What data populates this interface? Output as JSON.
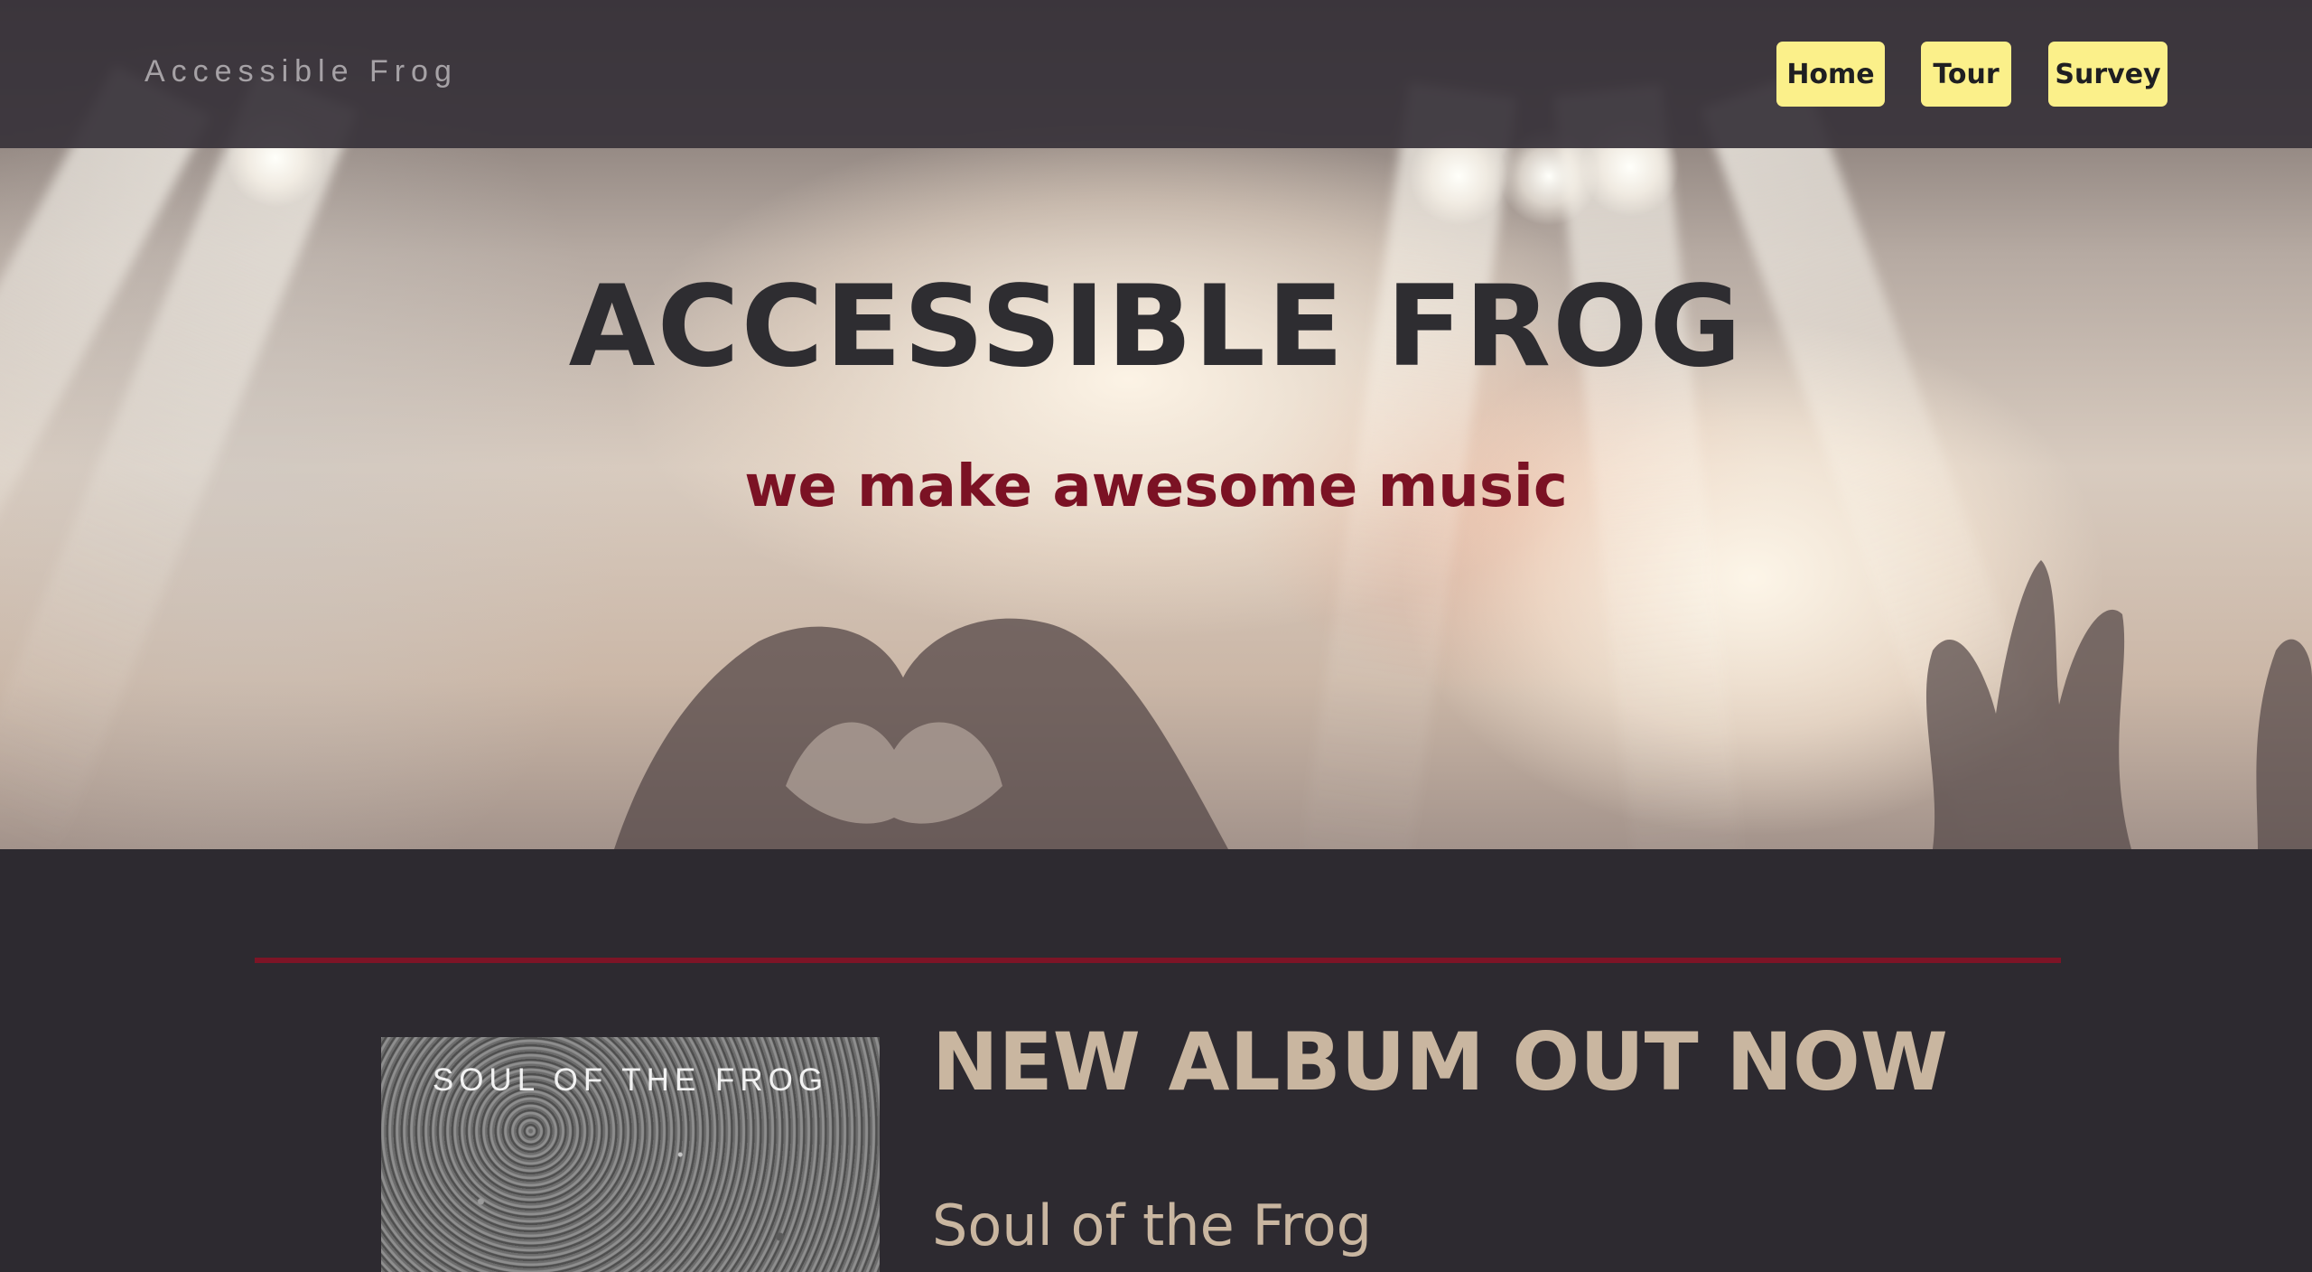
{
  "navbar": {
    "brand": "Accessible Frog",
    "links": [
      {
        "label": "Home"
      },
      {
        "label": "Tour"
      },
      {
        "label": "Survey"
      }
    ]
  },
  "hero": {
    "title": "ACCESSIBLE FROG",
    "subtitle": "we make awesome music"
  },
  "album": {
    "cover_text": "SOUL OF THE FROG",
    "heading": "NEW ALBUM OUT NOW",
    "title": "Soul of the Frog"
  },
  "colors": {
    "nav_button": "#fbf08a",
    "accent_red": "#7b1224",
    "page_background": "#2d2a30",
    "album_text": "#c9b6a0"
  }
}
